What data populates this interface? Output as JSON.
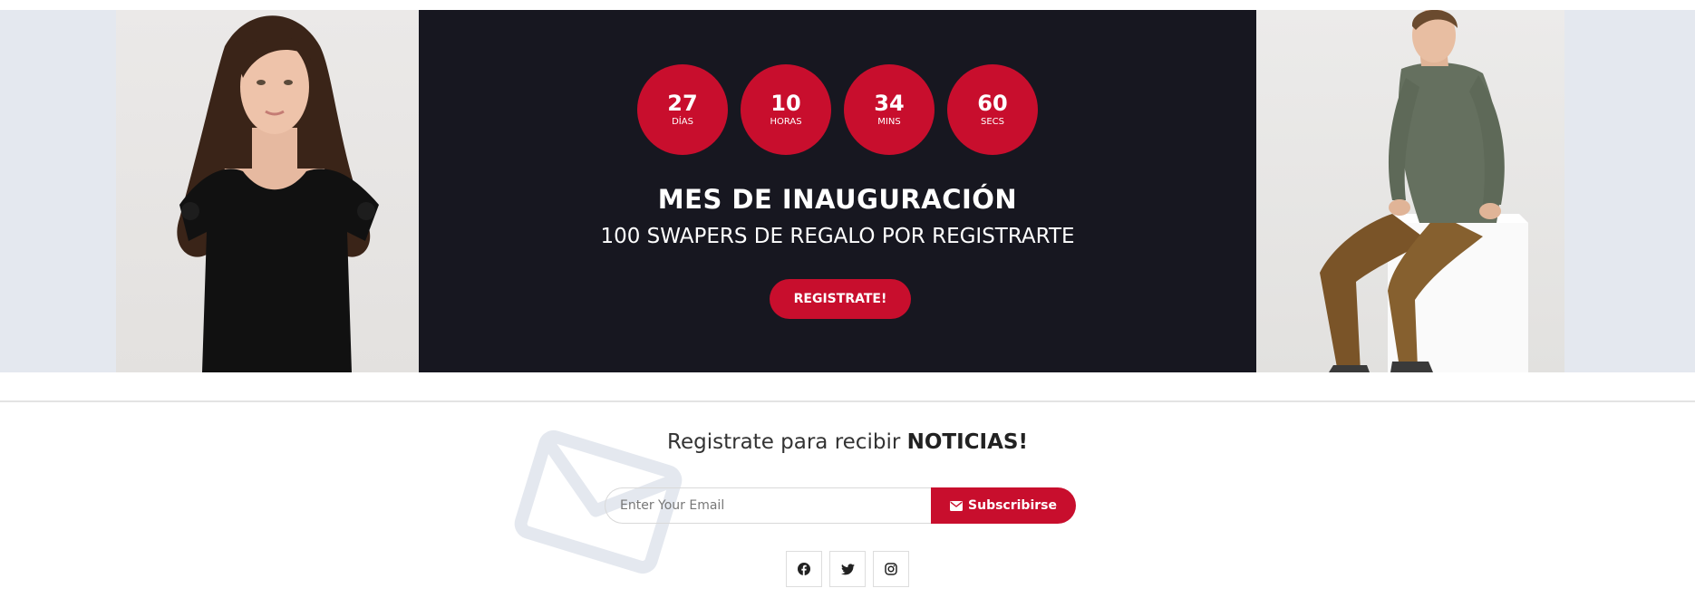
{
  "hero": {
    "countdown": [
      {
        "value": "27",
        "label": "DÍAS"
      },
      {
        "value": "10",
        "label": "HORAS"
      },
      {
        "value": "34",
        "label": "MINS"
      },
      {
        "value": "60",
        "label": "SECS"
      }
    ],
    "title": "MES DE INAUGURACIÓN",
    "subtitle": "100 SWAPERS DE REGALO POR REGISTRARTE",
    "cta_label": "REGISTRATE!"
  },
  "newsletter": {
    "title_prefix": "Registrate para recibir ",
    "title_bold": "NOTICIAS!",
    "email_placeholder": "Enter Your Email",
    "subscribe_label": "Subscribirse",
    "subscribe_icon": "envelope-icon"
  },
  "social": [
    {
      "name": "facebook-icon"
    },
    {
      "name": "twitter-icon"
    },
    {
      "name": "instagram-icon"
    }
  ],
  "colors": {
    "accent": "#c80e2d",
    "promo_bg": "#171720",
    "side_bg": "#e4e8ef"
  }
}
